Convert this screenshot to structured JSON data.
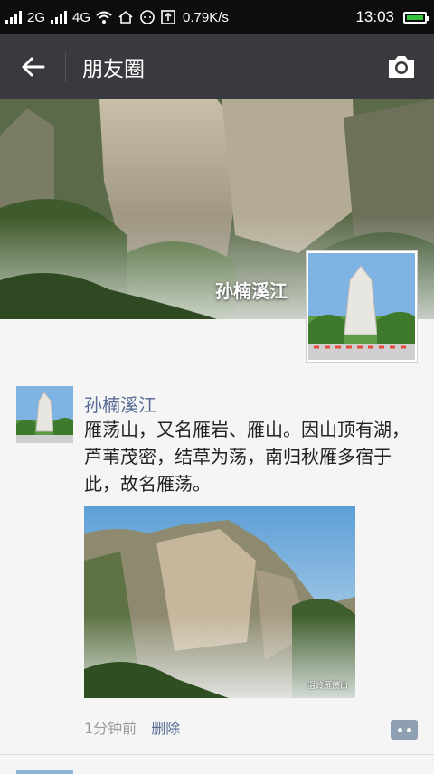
{
  "status_bar": {
    "sim1": "2G",
    "sim2": "4G",
    "speed": "0.79K/s",
    "time": "13:03"
  },
  "title_bar": {
    "title": "朋友圈"
  },
  "cover": {
    "name": "孙楠溪江"
  },
  "post": {
    "author": "孙楠溪江",
    "text": "雁荡山，又名雁岩、雁山。因山顶有湖，芦苇茂密，结草为荡，南归秋雁多宿于此，故名雁荡。",
    "image_watermark": "温岭雁荡山",
    "time": "1分钟前",
    "delete_label": "删除"
  },
  "colors": {
    "title_bar_bg": "#393a3e",
    "link_blue": "#576b95",
    "battery_green": "#36c53b"
  }
}
